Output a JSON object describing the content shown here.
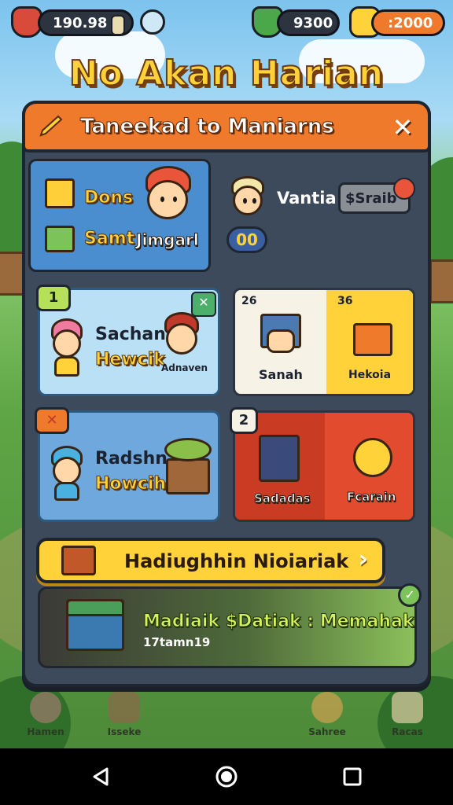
{
  "hud": {
    "left_value": "190.98",
    "mid_value": "9300",
    "right_value": ":2000"
  },
  "game_title": "No Akan Harian",
  "panel": {
    "title": "Taneekad to Maniarns",
    "close_label": "✕"
  },
  "profile": {
    "line1": "Dons",
    "line2": "Samt",
    "line2_b": "Jimgarl",
    "friend_name": "Vantia",
    "friend_tag": "$Sraib",
    "friend_score": "00"
  },
  "cards": [
    {
      "badge": "1",
      "title": "Sachan",
      "subtitle": "Hewcik",
      "tag": "Adnaven"
    },
    {
      "badge_left": "26",
      "badge_right": "36",
      "left_label": "Sanah",
      "right_label": "Hekoia"
    },
    {
      "badge": "✕",
      "title": "Radshn",
      "subtitle": "Howcih"
    },
    {
      "badge": "2",
      "left_label": "Sadadas",
      "right_label": "Fcarain"
    }
  ],
  "banner": {
    "label": "Hadiughhin Nioiariak",
    "chevron": "›"
  },
  "reward": {
    "title": "Madiaik $Datiak : Memahak",
    "subtitle": "17tamn19"
  },
  "bottom_nav": [
    "Hamen",
    "Isseke",
    "Sahree",
    "Racas"
  ],
  "colors": {
    "accent_orange": "#f07a2c",
    "accent_yellow": "#ffd23a",
    "panel": "#3c4a5b",
    "card_blue": "#8fc7ea",
    "card_red": "#e34b2e"
  }
}
